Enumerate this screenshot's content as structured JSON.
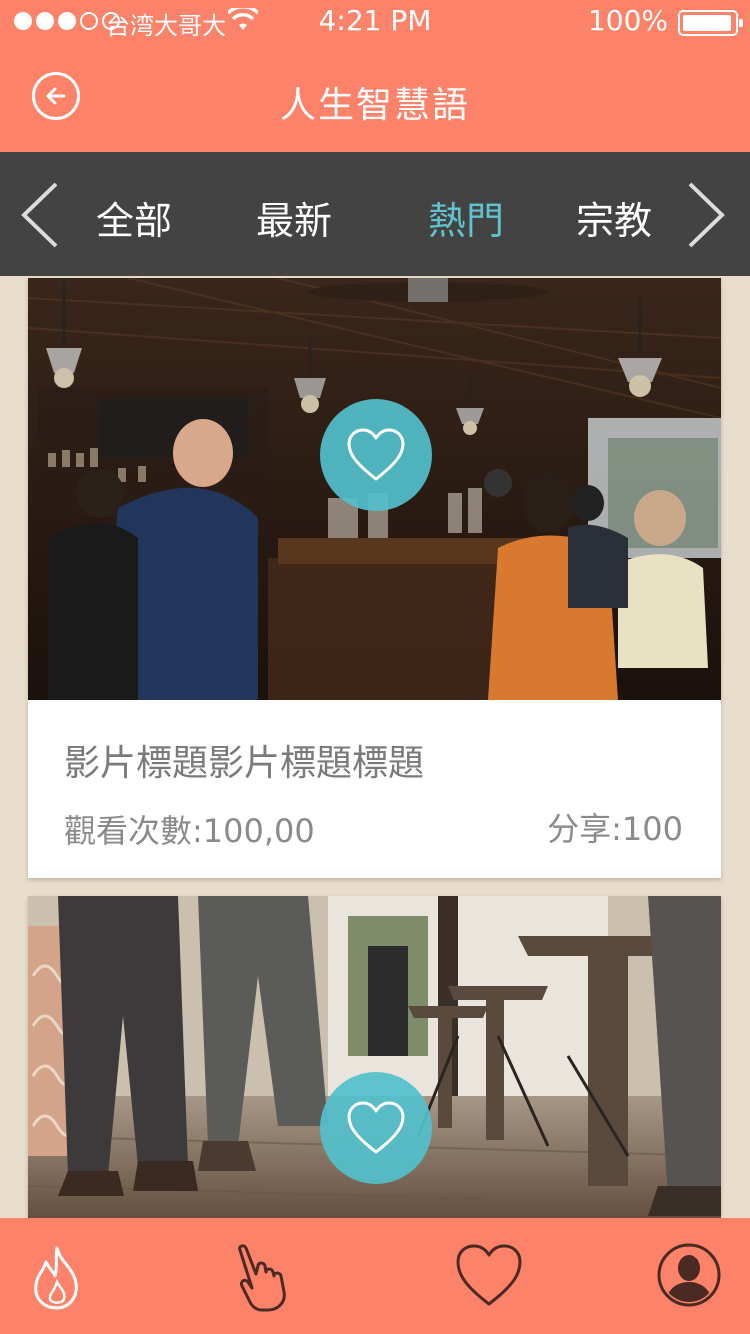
{
  "status_bar": {
    "carrier": "台湾大哥大",
    "time": "4:21 PM",
    "battery": "100%"
  },
  "header": {
    "title": "人生智慧語",
    "back_icon": "back-arrow-circle-icon"
  },
  "categories": {
    "tabs": [
      {
        "label": "全部",
        "active": false
      },
      {
        "label": "最新",
        "active": false
      },
      {
        "label": "熱門",
        "active": true
      },
      {
        "label": "宗教",
        "active": false
      }
    ],
    "active_color": "#5fc4cf"
  },
  "feed": {
    "items": [
      {
        "title": "影片標題影片標題標題",
        "views": "觀看次數:100,00",
        "shares": "分享:100"
      },
      {}
    ]
  },
  "tabbar": {
    "items": [
      "flame-icon",
      "hand-pointer-icon",
      "heart-icon",
      "profile-icon"
    ]
  },
  "colors": {
    "accent": "#fc8269",
    "category_bar": "#434343",
    "like_button": "#52c0cc",
    "background": "#e8dccb"
  }
}
